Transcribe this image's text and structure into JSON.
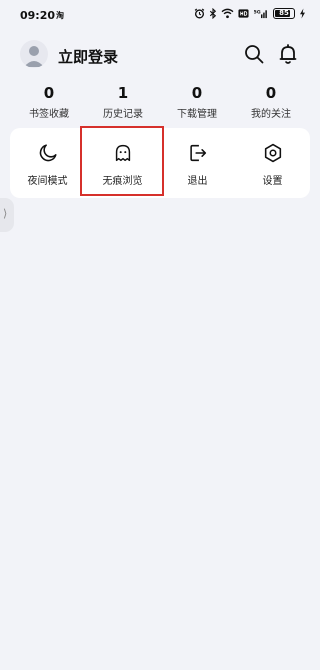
{
  "status_bar": {
    "time": "09:20",
    "app_indicator": "淘",
    "network": "5G",
    "battery": "85",
    "battery_level": 0.85,
    "icons": [
      "alarm-icon",
      "bluetooth-icon",
      "wifi-icon",
      "hd-icon",
      "signal-icon",
      "battery-icon",
      "charging-icon"
    ]
  },
  "header": {
    "login_label": "立即登录",
    "search_icon": "search-icon",
    "bell_icon": "bell-icon"
  },
  "stats": [
    {
      "value": "0",
      "label": "书签收藏"
    },
    {
      "value": "1",
      "label": "历史记录"
    },
    {
      "value": "0",
      "label": "下载管理"
    },
    {
      "value": "0",
      "label": "我的关注"
    }
  ],
  "actions": [
    {
      "label": "夜间模式",
      "icon": "moon-icon"
    },
    {
      "label": "无痕浏览",
      "icon": "ghost-icon",
      "highlighted": true
    },
    {
      "label": "退出",
      "icon": "exit-icon"
    },
    {
      "label": "设置",
      "icon": "settings-icon"
    }
  ],
  "side_handle": {
    "glyph": "⟩"
  },
  "colors": {
    "background": "#f2f3f8",
    "card": "#ffffff",
    "highlight_border": "#d6302b",
    "text": "#111111"
  }
}
